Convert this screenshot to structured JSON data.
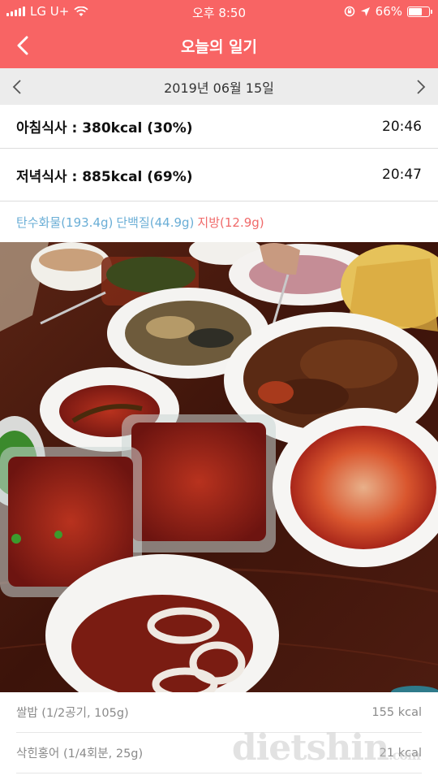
{
  "status_bar": {
    "carrier": "LG U+",
    "time": "오후 8:50",
    "battery": "66%",
    "battery_level": 0.66
  },
  "header": {
    "title": "오늘의 일기"
  },
  "date_nav": {
    "date": "2019년 06월 15일"
  },
  "meals": [
    {
      "name": "아침식사 : 380kcal (30%)",
      "time": "20:46"
    },
    {
      "name": "저녁식사 : 885kcal (69%)",
      "time": "20:47"
    }
  ],
  "nutrients": {
    "carb": "탄수화물(193.4g)",
    "protein": "단백질(44.9g)",
    "fat": "지방(12.9g)"
  },
  "photo": {
    "description_icon": "meal-photo"
  },
  "food_items": [
    {
      "name": "쌀밥 (1/2공기, 105g)",
      "kcal": "155 kcal"
    },
    {
      "name": "삭힌홍어 (1/4회분, 25g)",
      "kcal": "21 kcal"
    }
  ],
  "watermark": {
    "main": "dietshin",
    "suffix": ".com"
  },
  "colors": {
    "accent": "#f86464",
    "carb": "#6aaed6",
    "fat": "#f06a6a"
  }
}
